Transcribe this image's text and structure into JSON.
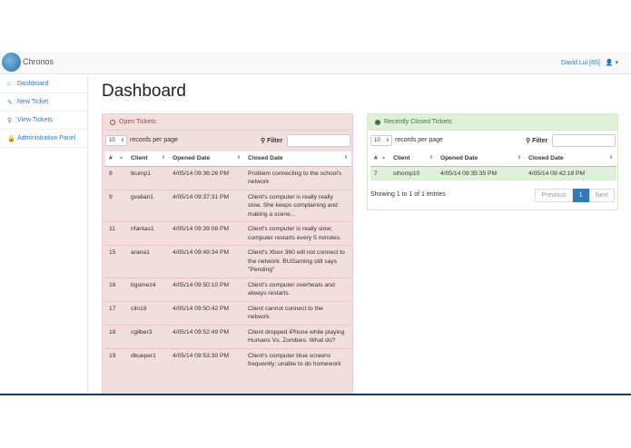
{
  "app": {
    "brand": "Chronos",
    "user": "David Lui [65]"
  },
  "sidebar": {
    "items": [
      {
        "label": "Dashboard",
        "icon": "dashboard-icon",
        "glyph": "⌂"
      },
      {
        "label": "New Ticket",
        "icon": "tag-icon",
        "glyph": "✎"
      },
      {
        "label": "View Tickets",
        "icon": "search-icon",
        "glyph": "⚲"
      },
      {
        "label": "Administration Panel",
        "icon": "lock-icon",
        "glyph": "🔒"
      }
    ]
  },
  "main": {
    "title": "Dashboard"
  },
  "open_panel": {
    "title": "Open Tickets",
    "page_size": "10",
    "records_per_page": "records per page",
    "filter_label": "Filter",
    "columns": [
      "#",
      "Client",
      "Opened Date",
      "Closed Date"
    ],
    "rows": [
      [
        "8",
        "tkump1",
        "4/05/14 09:36:26 PM",
        "Problem connecting to the school's network"
      ],
      [
        "9",
        "gvalian1",
        "4/05/14 09:37:31 PM",
        "Client's computer is really really slow. She keeps complaining and making a scene..."
      ],
      [
        "11",
        "nfantas1",
        "4/05/14 09:39:08 PM",
        "Client's computer is really slow; computer restarts every 5 minutes."
      ],
      [
        "15",
        "arana1",
        "4/05/14 09:49:34 PM",
        "Client's Xbox 360 will not connect to the network. BUGaming still says \"Pending\""
      ],
      [
        "16",
        "bgomez4",
        "4/05/14 09:50:10 PM",
        "Client's computer overheats and always restarts."
      ],
      [
        "17",
        "clin18",
        "4/05/14 09:50:42 PM",
        "Client cannot connect to the network."
      ],
      [
        "18",
        "cgilber3",
        "4/05/14 09:52:49 PM",
        "Client dropped iPhone while playing Humans Vs. Zombies. What do?"
      ],
      [
        "19",
        "dkueper1",
        "4/05/14 09:53:30 PM",
        "Client's computer blue screens frequently; unable to do homework"
      ]
    ]
  },
  "closed_panel": {
    "title": "Recently Closed Tickets",
    "page_size": "10",
    "records_per_page": "records per page",
    "filter_label": "Filter",
    "columns": [
      "#",
      "Client",
      "Opened Date",
      "Closed Date"
    ],
    "rows": [
      [
        "7",
        "sthomp10",
        "4/05/14 09:35:35 PM",
        "4/05/14 09:42:18 PM"
      ]
    ],
    "info": "Showing 1 to 1 of 1 entries",
    "pager": {
      "previous": "Previous",
      "current": "1",
      "next": "Next"
    }
  }
}
